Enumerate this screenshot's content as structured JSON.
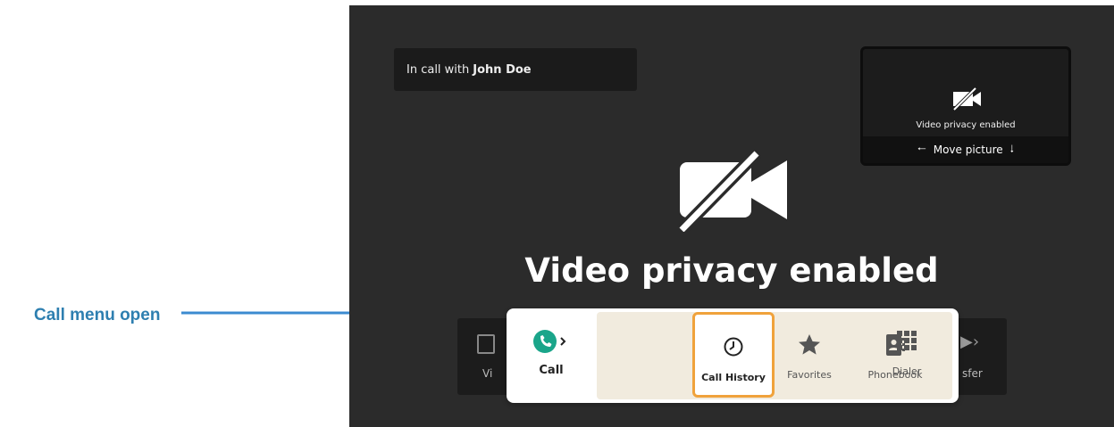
{
  "annotation": {
    "label": "Call menu open"
  },
  "banner": {
    "prefix": "In call with",
    "name": "John Doe"
  },
  "pip": {
    "status": "Video privacy enabled",
    "move_label": "Move picture"
  },
  "main": {
    "status": "Video privacy enabled"
  },
  "underlying": {
    "left_label": "Vi",
    "right_label": "sfer"
  },
  "call_menu": {
    "call_label": "Call",
    "items": [
      {
        "label": "Call History",
        "icon": "clock-icon",
        "selected": true
      },
      {
        "label": "Favorites",
        "icon": "star-icon"
      },
      {
        "label": "Phonebook",
        "icon": "phonebook-icon"
      },
      {
        "label": "Dialer",
        "icon": "dialpad-icon"
      }
    ]
  },
  "colors": {
    "accent": "#f0a23b",
    "call_green": "#1aa58a",
    "annotation": "#2e7fb0"
  }
}
